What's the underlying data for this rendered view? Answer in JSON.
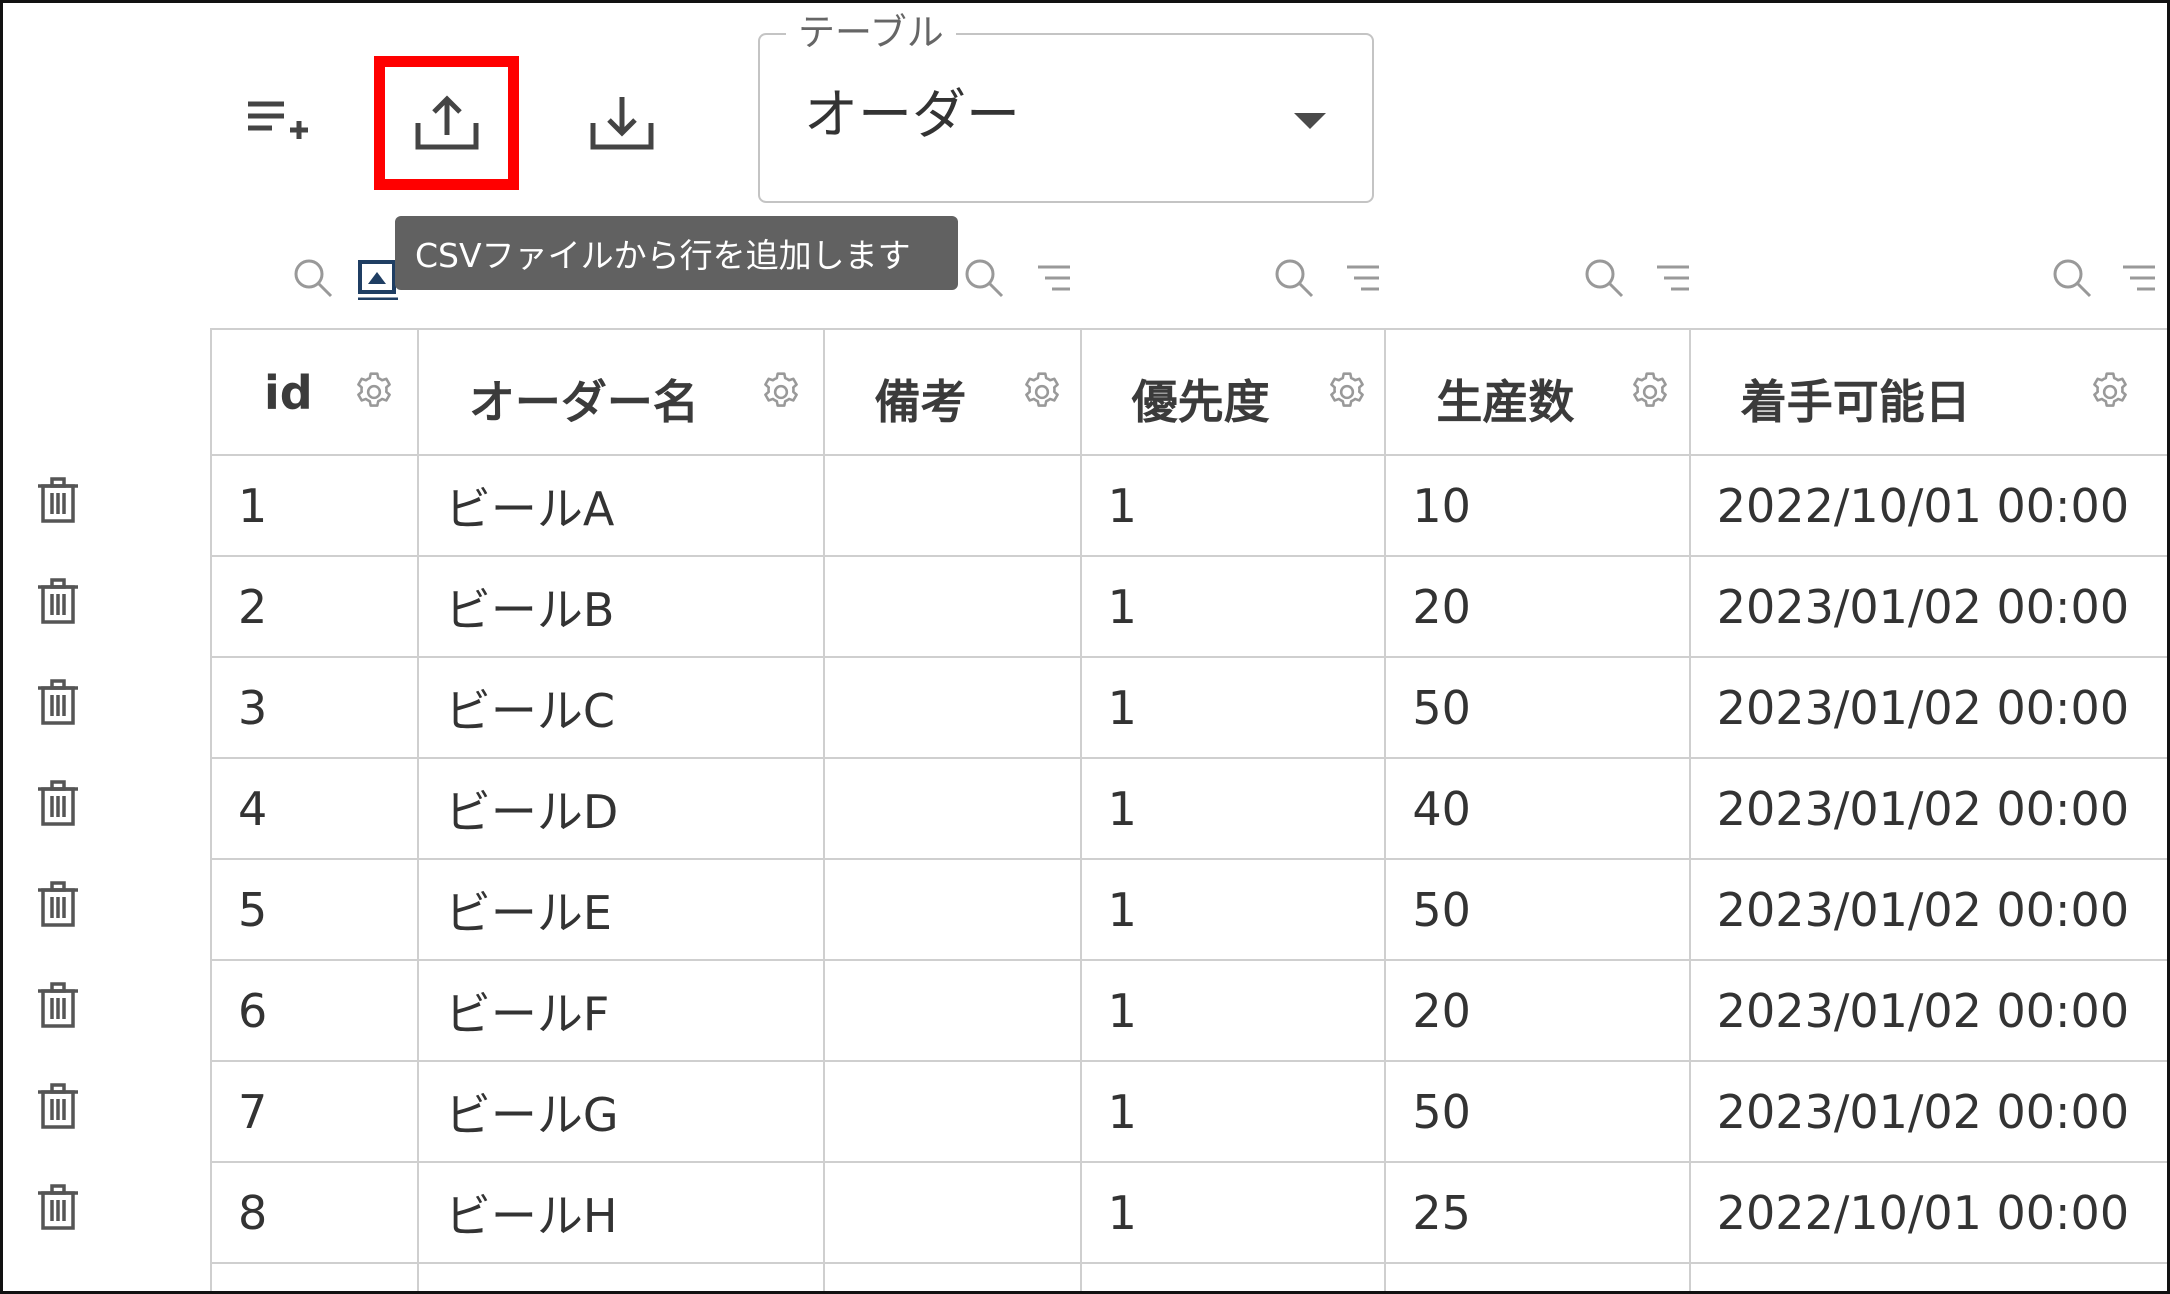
{
  "toolbar": {
    "add_row_icon": "playlist-add-icon",
    "upload_icon": "upload-icon",
    "download_icon": "download-icon"
  },
  "table_select": {
    "legend": "テーブル",
    "value": "オーダー"
  },
  "tooltip": "CSVファイルから行を追加します",
  "columns": [
    {
      "label": "id"
    },
    {
      "label": "オーダー名"
    },
    {
      "label": "備考"
    },
    {
      "label": "優先度"
    },
    {
      "label": "生産数"
    },
    {
      "label": "着手可能日"
    }
  ],
  "rows": [
    {
      "id": "1",
      "name": "ビールA",
      "note": "",
      "priority": "1",
      "quantity": "10",
      "start": "2022/10/01 00:00"
    },
    {
      "id": "2",
      "name": "ビールB",
      "note": "",
      "priority": "1",
      "quantity": "20",
      "start": "2023/01/02 00:00"
    },
    {
      "id": "3",
      "name": "ビールC",
      "note": "",
      "priority": "1",
      "quantity": "50",
      "start": "2023/01/02 00:00"
    },
    {
      "id": "4",
      "name": "ビールD",
      "note": "",
      "priority": "1",
      "quantity": "40",
      "start": "2023/01/02 00:00"
    },
    {
      "id": "5",
      "name": "ビールE",
      "note": "",
      "priority": "1",
      "quantity": "50",
      "start": "2023/01/02 00:00"
    },
    {
      "id": "6",
      "name": "ビールF",
      "note": "",
      "priority": "1",
      "quantity": "20",
      "start": "2023/01/02 00:00"
    },
    {
      "id": "7",
      "name": "ビールG",
      "note": "",
      "priority": "1",
      "quantity": "50",
      "start": "2023/01/02 00:00"
    },
    {
      "id": "8",
      "name": "ビールH",
      "note": "",
      "priority": "1",
      "quantity": "25",
      "start": "2022/10/01 00:00"
    }
  ]
}
